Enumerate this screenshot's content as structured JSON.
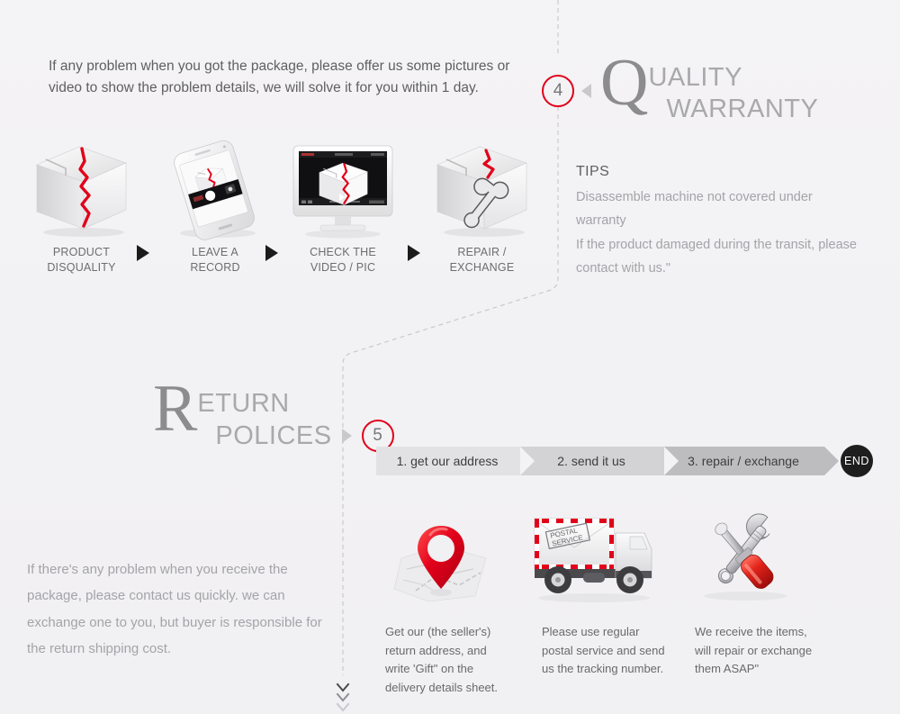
{
  "colors": {
    "background": "#f3f2f4",
    "accent_red": "#e2001a",
    "heading_gray": "#8c8c8f",
    "subheading_gray": "#a9a9ac",
    "body_gray": "#5f5f62",
    "muted_gray": "#a4a4a8",
    "end_black": "#1e1e1e",
    "chevron_1": "#e2e2e4",
    "chevron_2": "#d3d3d5",
    "chevron_3": "#bdbdbf"
  },
  "quality": {
    "badge_number": "4",
    "heading_initial": "Q",
    "heading_line1": "UALITY",
    "heading_line2": "WARRANTY",
    "intro": "If any problem when you got the package, please offer us some pictures or video to show the problem details, we will solve it for you within 1 day.",
    "tips_title": "TIPS",
    "tips_lines": [
      "Disassemble machine not covered under",
      "warranty",
      "If the product damaged during the transit, please",
      "contact with us.\""
    ],
    "steps": [
      {
        "icon": "cracked-box-icon",
        "line1": "PRODUCT",
        "line2": "DISQUALITY"
      },
      {
        "icon": "phone-camera-icon",
        "line1": "LEAVE A",
        "line2": "RECORD"
      },
      {
        "icon": "monitor-video-icon",
        "line1": "CHECK THE",
        "line2": "VIDEO / PIC"
      },
      {
        "icon": "box-wrench-icon",
        "line1": "REPAIR /",
        "line2": "EXCHANGE"
      }
    ]
  },
  "returns": {
    "badge_number": "5",
    "heading_initial": "R",
    "heading_line1": "ETURN",
    "heading_line2": "POLICES",
    "note": "If there's any problem when you receive the package, please contact us quickly. we can exchange one to you, but buyer is responsible for the return shipping cost.",
    "flow_steps": [
      "1. get our address",
      "2. send it us",
      "3. repair / exchange"
    ],
    "flow_end": "END",
    "cards": [
      {
        "icon": "map-pin-icon",
        "caption": "Get our (the seller's) return address, and write 'Gift\" on the delivery details sheet."
      },
      {
        "icon": "postal-truck-icon",
        "caption": "Please use regular postal service and send us the tracking number."
      },
      {
        "icon": "wrench-screwdriver-icon",
        "caption": "We receive the items, will repair or exchange them ASAP\""
      }
    ]
  }
}
